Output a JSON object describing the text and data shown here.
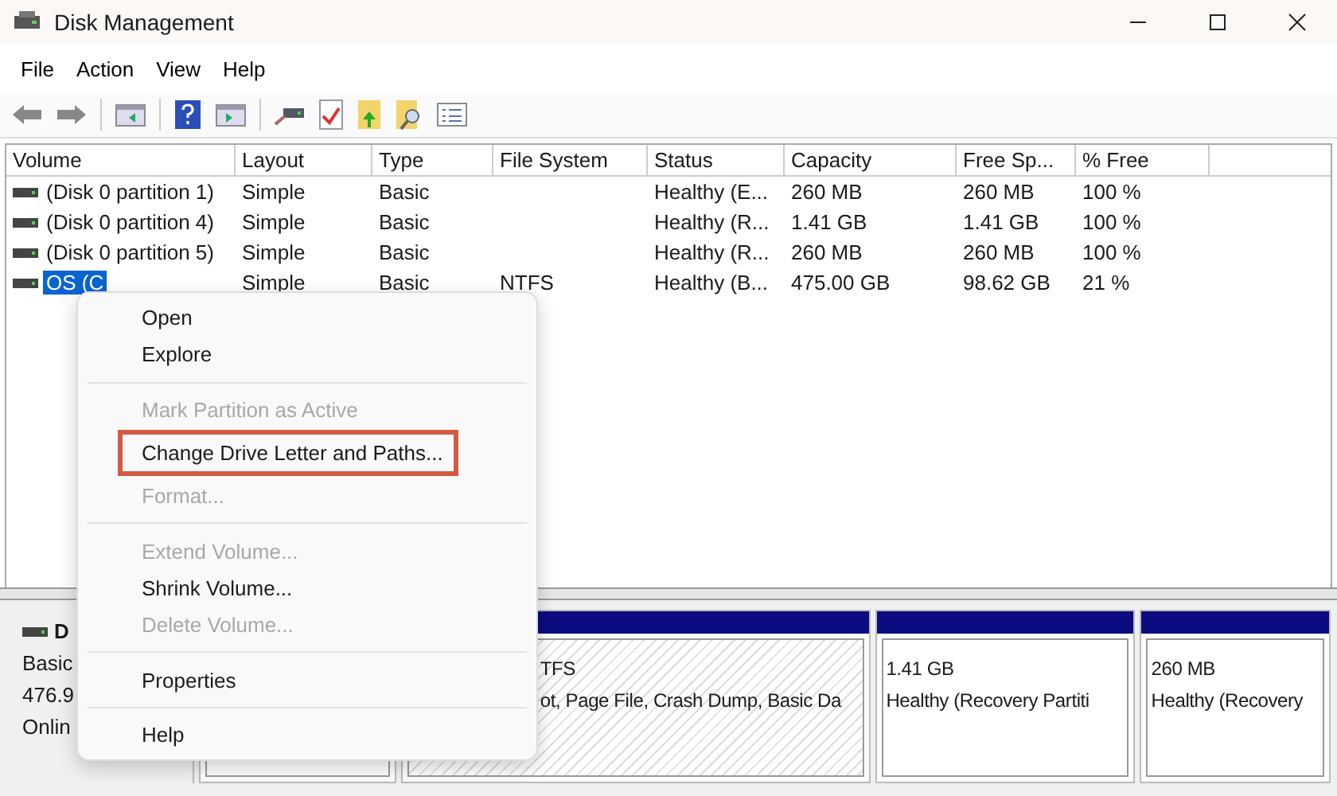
{
  "window": {
    "title": "Disk Management"
  },
  "menu_bar": [
    "File",
    "Action",
    "View",
    "Help"
  ],
  "table": {
    "columns": [
      "Volume",
      "Layout",
      "Type",
      "File System",
      "Status",
      "Capacity",
      "Free Sp...",
      "% Free"
    ],
    "rows": [
      {
        "selected": false,
        "cells": [
          "(Disk 0 partition 1)",
          "Simple",
          "Basic",
          "",
          "Healthy (E...",
          "260 MB",
          "260 MB",
          "100 %"
        ]
      },
      {
        "selected": false,
        "cells": [
          "(Disk 0 partition 4)",
          "Simple",
          "Basic",
          "",
          "Healthy (R...",
          "1.41 GB",
          "1.41 GB",
          "100 %"
        ]
      },
      {
        "selected": false,
        "cells": [
          "(Disk 0 partition 5)",
          "Simple",
          "Basic",
          "",
          "Healthy (R...",
          "260 MB",
          "260 MB",
          "100 %"
        ]
      },
      {
        "selected": true,
        "cells": [
          "OS (C",
          "Simple",
          "Basic",
          "NTFS",
          "Healthy (B...",
          "475.00 GB",
          "98.62 GB",
          "21 %"
        ]
      }
    ]
  },
  "disk": {
    "name": "D",
    "lines": [
      "Basic",
      "476.9",
      "Onlin"
    ],
    "partitions": [
      {
        "hatched": false
      },
      {
        "size": "TFS",
        "status": "ot, Page File, Crash Dump, Basic Da",
        "hatched": true
      },
      {
        "size": "1.41 GB",
        "status": "Healthy (Recovery Partiti",
        "hatched": false
      },
      {
        "size": "260 MB",
        "status": "Healthy (Recovery",
        "hatched": false
      }
    ]
  },
  "context_menu": [
    {
      "kind": "item",
      "label": "Open",
      "disabled": false,
      "annotated": false
    },
    {
      "kind": "item",
      "label": "Explore",
      "disabled": false,
      "annotated": false
    },
    {
      "kind": "separator"
    },
    {
      "kind": "item",
      "label": "Mark Partition as Active",
      "disabled": true,
      "annotated": false
    },
    {
      "kind": "item",
      "label": "Change Drive Letter and Paths...",
      "disabled": false,
      "annotated": true
    },
    {
      "kind": "item",
      "label": "Format...",
      "disabled": true,
      "annotated": false
    },
    {
      "kind": "separator"
    },
    {
      "kind": "item",
      "label": "Extend Volume...",
      "disabled": true,
      "annotated": false
    },
    {
      "kind": "item",
      "label": "Shrink Volume...",
      "disabled": false,
      "annotated": false
    },
    {
      "kind": "item",
      "label": "Delete Volume...",
      "disabled": true,
      "annotated": false
    },
    {
      "kind": "separator"
    },
    {
      "kind": "item",
      "label": "Properties",
      "disabled": false,
      "annotated": false
    },
    {
      "kind": "separator"
    },
    {
      "kind": "item",
      "label": "Help",
      "disabled": false,
      "annotated": false
    }
  ]
}
